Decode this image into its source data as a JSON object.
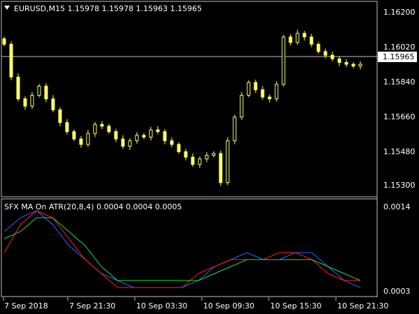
{
  "main_chart": {
    "title": "EURUSD,M15  1.15978 1.15978 1.15963 1.15965",
    "price_labels": [
      "1.16200",
      "1.16020",
      "1.15840",
      "1.15660",
      "1.15480",
      "1.15300"
    ],
    "current_price": "1.15965",
    "candle_color": "#ffff66",
    "current_line_color": "#c0c0c0"
  },
  "indicator": {
    "title": "SFX MA On ATR(20,8,4) 0.0004 0.0004 0.0005",
    "scale_labels": [
      "0.0014",
      "0.0003"
    ]
  },
  "time_axis": {
    "labels": [
      "7 Sep 2018",
      "7 Sep 21:30",
      "10 Sep 03:30",
      "10 Sep 09:30",
      "10 Sep 15:30",
      "10 Sep 21:30"
    ]
  },
  "chart_data": [
    {
      "type": "candlestick",
      "title": "EURUSD,M15",
      "ylim": [
        1.1525,
        1.163
      ],
      "ohlc_close_path": [
        1.1608,
        1.159,
        1.1578,
        1.1574,
        1.158,
        1.1585,
        1.1578,
        1.1572,
        1.1565,
        1.156,
        1.1556,
        1.1553,
        1.1559,
        1.1564,
        1.1563,
        1.156,
        1.1556,
        1.1552,
        1.1555,
        1.1558,
        1.1557,
        1.1561,
        1.156,
        1.1555,
        1.1553,
        1.1549,
        1.1546,
        1.1542,
        1.1545,
        1.1547,
        1.1548,
        1.1532,
        1.1555,
        1.1568,
        1.158,
        1.1587,
        1.1583,
        1.1579,
        1.1578,
        1.1586,
        1.1612,
        1.1609,
        1.1614,
        1.1612,
        1.1608,
        1.1604,
        1.1602,
        1.16,
        1.1598,
        1.1597,
        1.1596,
        1.1597
      ]
    },
    {
      "type": "line",
      "title": "SFX MA On ATR(20,8,4)",
      "ylim": [
        0.0002,
        0.0015
      ],
      "series": [
        {
          "color": "#3366ff",
          "values": [
            0.0011,
            0.0013,
            0.0014,
            0.0012,
            0.0009,
            0.0007,
            0.0005,
            0.0004,
            0.0003,
            0.0003,
            0.0003,
            0.0003,
            0.0004,
            0.0006,
            0.0007,
            0.0008,
            0.0007,
            0.0007,
            0.0008,
            0.0008,
            0.0006,
            0.0004,
            0.0003
          ]
        },
        {
          "color": "#ff2020",
          "values": [
            0.0008,
            0.0012,
            0.0014,
            0.0013,
            0.001,
            0.0007,
            0.0005,
            0.0003,
            0.0003,
            0.0003,
            0.0003,
            0.0003,
            0.0005,
            0.0006,
            0.0007,
            0.0007,
            0.0007,
            0.0008,
            0.0008,
            0.0007,
            0.0005,
            0.0004,
            0.0004
          ]
        },
        {
          "color": "#22dd44",
          "values": [
            0.001,
            0.0011,
            0.0013,
            0.0013,
            0.0011,
            0.0009,
            0.0006,
            0.0004,
            0.0004,
            0.0004,
            0.0004,
            0.0004,
            0.0004,
            0.0005,
            0.0006,
            0.0007,
            0.0007,
            0.0007,
            0.0007,
            0.0007,
            0.0006,
            0.0005,
            0.0004
          ]
        }
      ]
    }
  ]
}
